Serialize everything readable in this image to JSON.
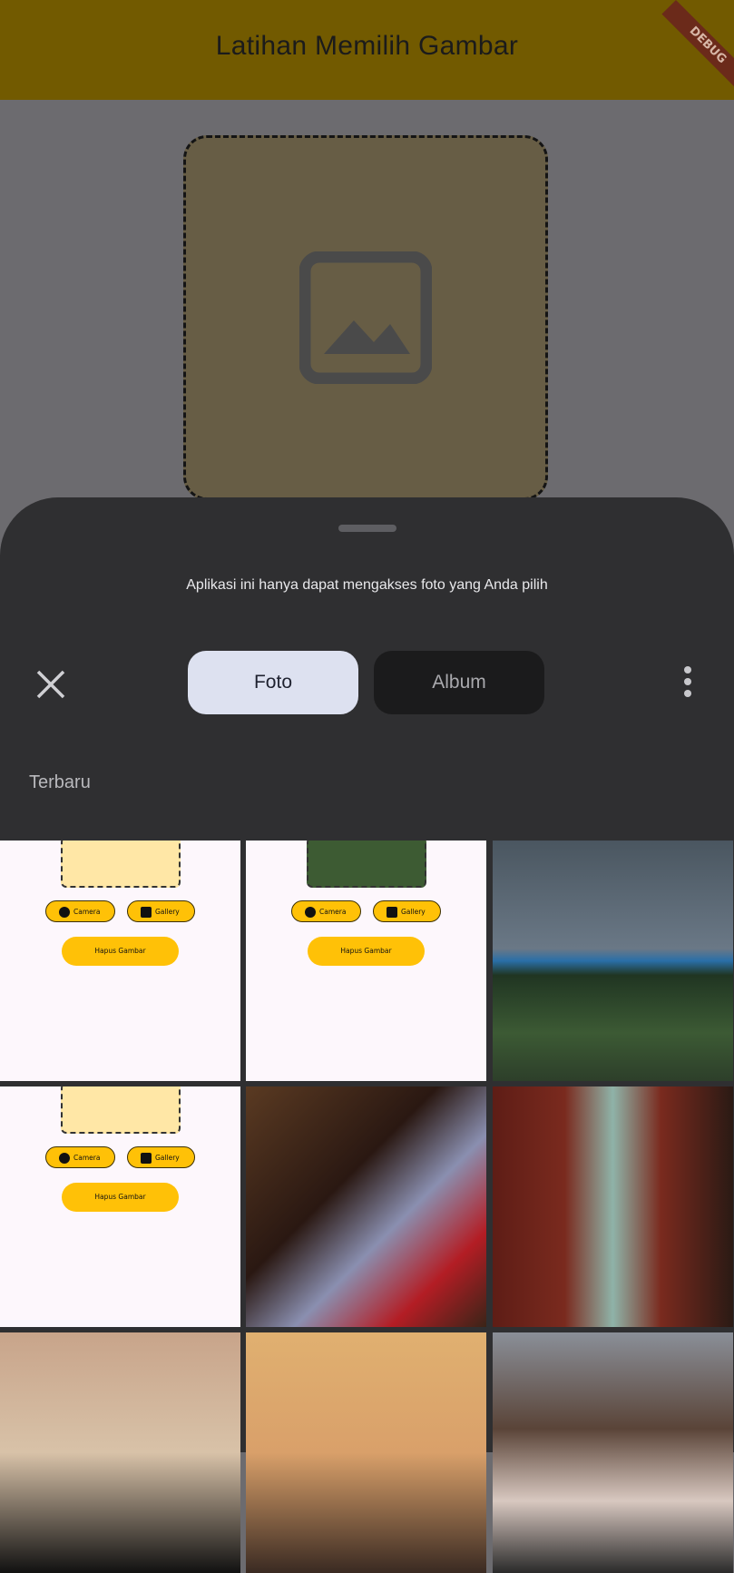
{
  "app": {
    "title": "Latihan Memilih Gambar",
    "debug_banner": "DEBUG"
  },
  "sheet": {
    "message": "Aplikasi ini hanya dapat mengakses foto yang Anda pilih",
    "tabs": [
      {
        "label": "Foto",
        "selected": true
      },
      {
        "label": "Album",
        "selected": false
      }
    ],
    "section": "Terbaru"
  },
  "thumbnails": [
    {
      "kind": "screenshot",
      "camera": "Camera",
      "gallery": "Gallery",
      "delete": "Hapus Gambar"
    },
    {
      "kind": "screenshot",
      "camera": "Camera",
      "gallery": "Gallery",
      "delete": "Hapus Gambar"
    },
    {
      "kind": "photo"
    },
    {
      "kind": "screenshot",
      "camera": "Camera",
      "gallery": "Gallery",
      "delete": "Hapus Gambar"
    },
    {
      "kind": "photo"
    },
    {
      "kind": "photo"
    },
    {
      "kind": "photo"
    },
    {
      "kind": "photo"
    },
    {
      "kind": "photo"
    }
  ],
  "colors": {
    "app_bar": "#725a00",
    "sheet": "#2f2f31",
    "accent_button": "#ffc107",
    "selected_tab": "#dde1f0"
  }
}
